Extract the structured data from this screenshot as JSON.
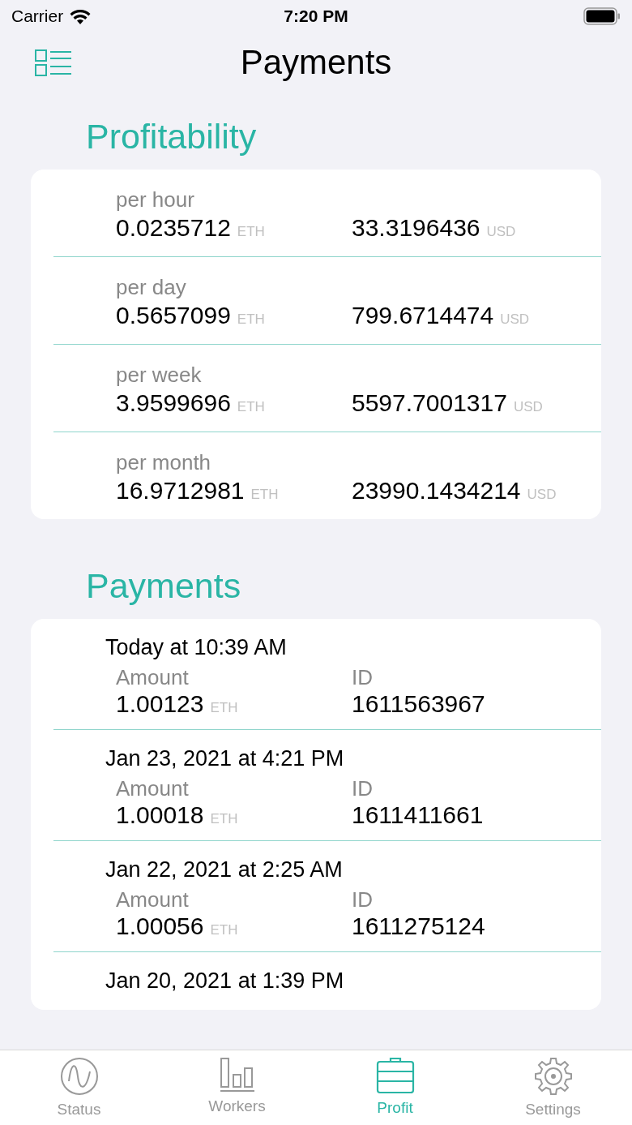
{
  "status_bar": {
    "carrier": "Carrier",
    "time": "7:20 PM"
  },
  "nav": {
    "title": "Payments"
  },
  "profitability": {
    "title": "Profitability",
    "rows": [
      {
        "period": "per hour",
        "eth": "0.0235712",
        "eth_unit": "ETH",
        "usd": "33.3196436",
        "usd_unit": "USD"
      },
      {
        "period": "per day",
        "eth": "0.5657099",
        "eth_unit": "ETH",
        "usd": "799.6714474",
        "usd_unit": "USD"
      },
      {
        "period": "per week",
        "eth": "3.9599696",
        "eth_unit": "ETH",
        "usd": "5597.7001317",
        "usd_unit": "USD"
      },
      {
        "period": "per month",
        "eth": "16.9712981",
        "eth_unit": "ETH",
        "usd": "23990.1434214",
        "usd_unit": "USD"
      }
    ]
  },
  "payments": {
    "title": "Payments",
    "items": [
      {
        "date": "Today at 10:39 AM",
        "amount_label": "Amount",
        "amount": "1.00123",
        "unit": "ETH",
        "id_label": "ID",
        "id": "1611563967"
      },
      {
        "date": "Jan 23, 2021 at 4:21 PM",
        "amount_label": "Amount",
        "amount": "1.00018",
        "unit": "ETH",
        "id_label": "ID",
        "id": "1611411661"
      },
      {
        "date": "Jan 22, 2021 at 2:25 AM",
        "amount_label": "Amount",
        "amount": "1.00056",
        "unit": "ETH",
        "id_label": "ID",
        "id": "1611275124"
      },
      {
        "date": "Jan 20, 2021 at 1:39 PM"
      }
    ]
  },
  "tab_bar": [
    {
      "label": "Status",
      "kind": "status",
      "selected": false
    },
    {
      "label": "Workers",
      "kind": "workers",
      "selected": false
    },
    {
      "label": "Profit",
      "kind": "profit",
      "selected": true
    },
    {
      "label": "Settings",
      "kind": "settings",
      "selected": false
    }
  ]
}
